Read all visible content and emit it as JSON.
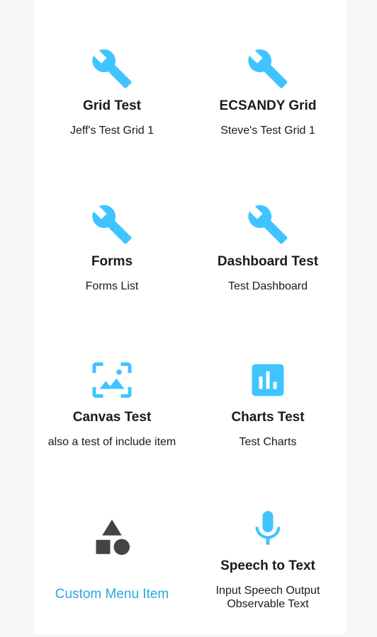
{
  "colors": {
    "accent": "#40c4ff",
    "link": "#2aa7e0",
    "shape_icon": "#444444"
  },
  "tiles": [
    {
      "icon": "wrench-icon",
      "title": "Grid Test",
      "subtitle": "Jeff's Test Grid 1"
    },
    {
      "icon": "wrench-icon",
      "title": "ECSANDY Grid",
      "subtitle": "Steve's Test Grid 1"
    },
    {
      "icon": "wrench-icon",
      "title": "Forms",
      "subtitle": "Forms List"
    },
    {
      "icon": "wrench-icon",
      "title": "Dashboard Test",
      "subtitle": "Test Dashboard"
    },
    {
      "icon": "image-frame-icon",
      "title": "Canvas Test",
      "subtitle": "also a test of include item"
    },
    {
      "icon": "bar-chart-icon",
      "title": "Charts Test",
      "subtitle": "Test Charts"
    },
    {
      "icon": "shapes-icon",
      "title": "",
      "subtitle": "Custom Menu Item"
    },
    {
      "icon": "microphone-icon",
      "title": "Speech to Text",
      "subtitle": "Input Speech Output Observable Text"
    }
  ]
}
